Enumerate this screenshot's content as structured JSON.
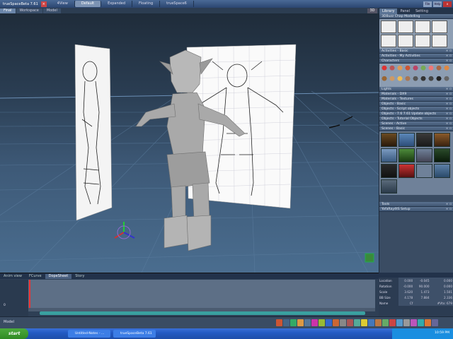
{
  "window": {
    "title": "trueSpaceBeta 7.61",
    "layout_tabs": [
      "4View",
      "Default",
      "Expanded",
      "Floating",
      "trueSpace6"
    ],
    "active_layout": "Default",
    "right_buttons": [
      "File",
      "Help"
    ]
  },
  "viewport": {
    "tabs": [
      "Final",
      "Workspace",
      "Model"
    ],
    "active_tab": "Final",
    "mode_badge": "3D"
  },
  "library_panel": {
    "tabs": [
      "Library",
      "Panel",
      "Setting"
    ],
    "active_tab": "Library",
    "sections": [
      "3DBuzz Chap Modelling",
      "Activities - Basic",
      "Activities - My Activities",
      "Characters",
      "Lights",
      "Materials - DX9",
      "Materials - Textures",
      "Objects - Basic",
      "Objects - Script objects",
      "Objects - 7.6 7.61 Update objects",
      "Objects - Tutorial Objects",
      "Scenes - Active",
      "Scenes - Basic",
      "Tools",
      "YafaRay4tS Setup"
    ]
  },
  "timeline": {
    "tabs": [
      "Anim view",
      "FCurve",
      "DopeSheet",
      "Story"
    ],
    "active_tab": "DopeSheet",
    "frame_label": "0"
  },
  "properties": {
    "rows": [
      {
        "label": "Location",
        "x": "0.000",
        "y": "-0.045",
        "z": "0.000"
      },
      {
        "label": "Rotation",
        "x": "-0.000",
        "y": "90.000",
        "z": "0.000"
      },
      {
        "label": "Scale",
        "x": "3.620",
        "y": "1.473",
        "z": "1.501"
      },
      {
        "label": "BB Size",
        "x": "4.178",
        "y": "7.884",
        "z": "2.336"
      },
      {
        "label": "Name",
        "x": "Cf",
        "y": "",
        "z": "#Vtx: 679"
      }
    ]
  },
  "statusbar": {
    "label": "Model"
  },
  "taskbar": {
    "start": "start",
    "tasks": [
      "Untitled-Notes - ...",
      "trueSpaceBeta 7.61"
    ],
    "clock": "10:59 PM"
  },
  "colors": {
    "viewport_top": "#1f2c3a",
    "viewport_bottom": "#4a6d8f",
    "panel_header": "#5b7290",
    "taskbar": "#235bc4"
  }
}
